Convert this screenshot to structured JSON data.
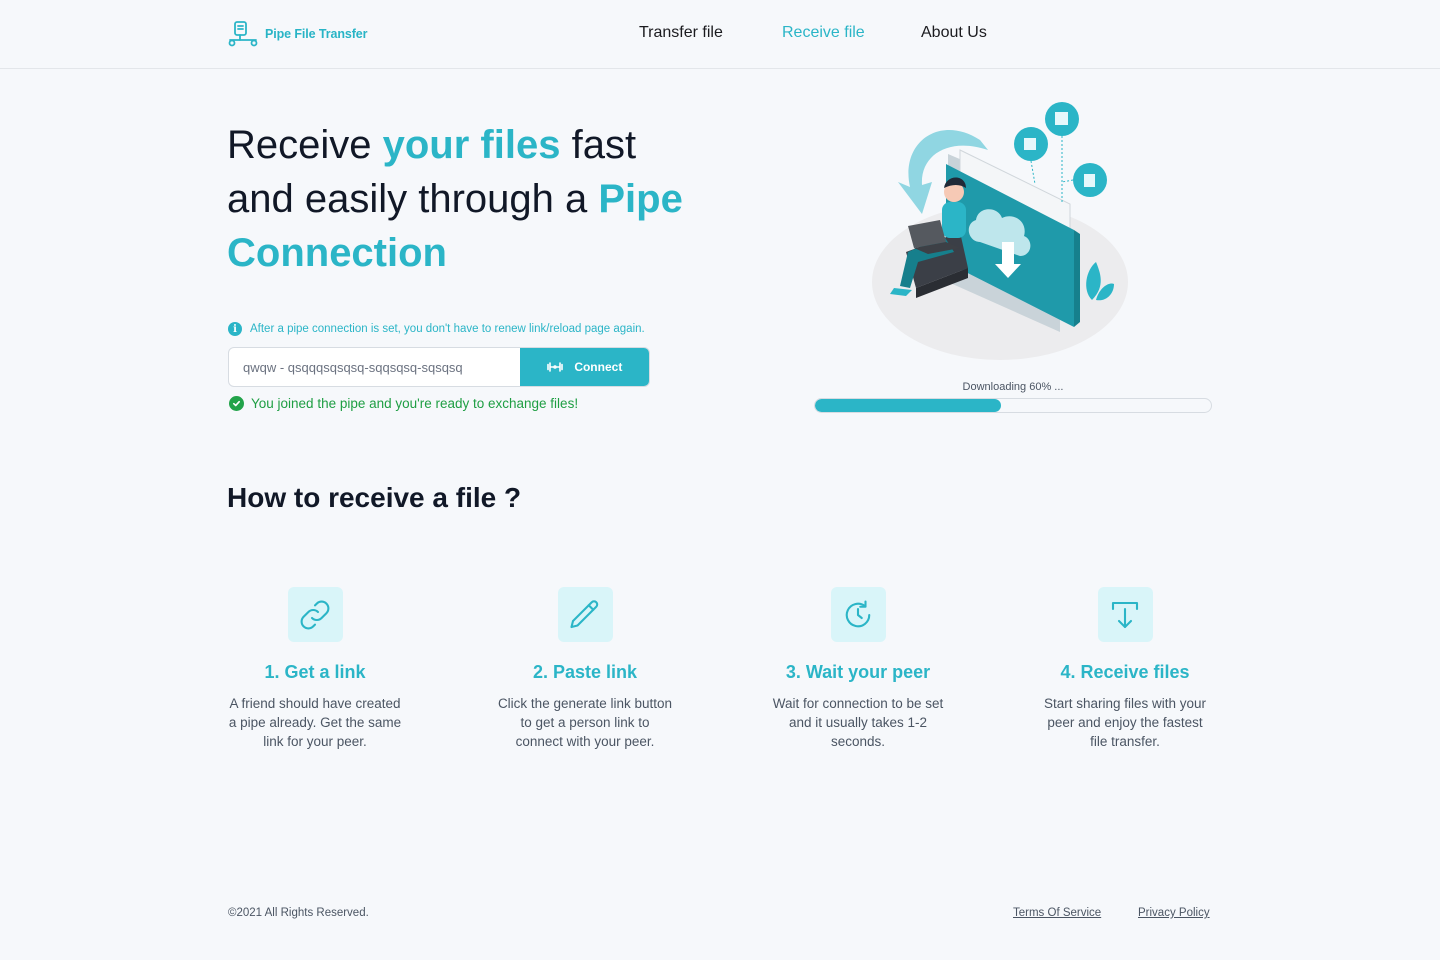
{
  "header": {
    "logo_text": "Pipe File Transfer",
    "nav": [
      {
        "label": "Transfer file",
        "active": false
      },
      {
        "label": "Receive file",
        "active": true
      },
      {
        "label": "About Us",
        "active": false
      }
    ]
  },
  "hero": {
    "title_part1": "Receive ",
    "title_accent1": "your files",
    "title_part2": " fast and easily through a ",
    "title_accent2": "Pipe Connection",
    "info_text": "After a pipe connection is set, you don't have to renew link/reload page again.",
    "input_value": "qwqw - qsqqqsqsqsq-sqqsqsq-sqsqsq",
    "connect_label": "Connect",
    "success_text": "You joined the pipe and you're ready to exchange files!"
  },
  "download": {
    "label": "Downloading 60% ...",
    "progress": 0.47
  },
  "how": {
    "title": "How to receive a file ?",
    "steps": [
      {
        "title": "1.  Get a link",
        "desc": "A friend should have created a pipe already. Get the same link for your peer.",
        "icon": "link-icon"
      },
      {
        "title": "2. Paste link",
        "desc": "Click the generate link button to get a person link to connect with your peer.",
        "icon": "pencil-icon"
      },
      {
        "title": "3.  Wait your peer",
        "desc": "Wait for connection to be set and it usually takes 1-2 seconds.",
        "icon": "clock-refresh-icon"
      },
      {
        "title": "4.  Receive files",
        "desc": "Start sharing files with your peer and enjoy the fastest file transfer.",
        "icon": "download-tray-icon"
      }
    ]
  },
  "footer": {
    "copyright": "©2021 All Rights Reserved.",
    "terms": "Terms Of Service",
    "privacy": "Privacy Policy"
  },
  "colors": {
    "accent": "#2bb5c7",
    "success": "#1e9e43",
    "background": "#f6f8fb"
  }
}
